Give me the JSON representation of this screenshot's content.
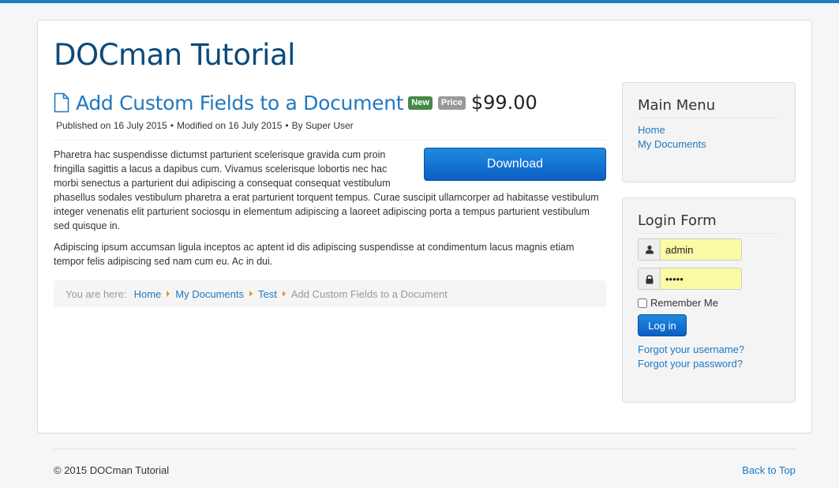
{
  "site": {
    "brand": "DOCman Tutorial"
  },
  "document": {
    "title": "Add Custom Fields to a Document",
    "badge_new": "New",
    "badge_price": "Price",
    "price": "$99.00",
    "published": "Published on 16 July 2015",
    "modified": "Modified on 16 July 2015",
    "author": "By Super User",
    "download_label": "Download",
    "paragraphs": [
      "Pharetra hac suspendisse dictumst parturient scelerisque gravida cum proin fringilla sagittis a lacus a dapibus cum. Vivamus scelerisque lobortis nec hac morbi senectus a parturient dui adipiscing a consequat consequat vestibulum phasellus sodales vestibulum pharetra a erat parturient torquent tempus. Curae suscipit ullamcorper ad habitasse vestibulum integer venenatis elit parturient sociosqu in elementum adipiscing a laoreet adipiscing porta a tempus parturient vestibulum sed quisque in.",
      "Adipiscing ipsum accumsan ligula inceptos ac aptent id dis adipiscing suspendisse at condimentum lacus magnis etiam tempor felis adipiscing sed nam cum eu. Ac in dui."
    ]
  },
  "breadcrumb": {
    "prefix": "You are here:",
    "items": [
      "Home",
      "My Documents",
      "Test",
      "Add Custom Fields to a Document"
    ]
  },
  "main_menu": {
    "title": "Main Menu",
    "items": [
      "Home",
      "My Documents"
    ]
  },
  "login": {
    "title": "Login Form",
    "username_value": "admin",
    "password_value": "•••••",
    "remember_label": "Remember Me",
    "submit_label": "Log in",
    "forgot_username": "Forgot your username?",
    "forgot_password": "Forgot your password?"
  },
  "footer": {
    "copyright": "© 2015 DOCman Tutorial",
    "back_to_top": "Back to Top"
  },
  "colors": {
    "accent": "#1f78c2",
    "brand": "#0d4a7a",
    "badge_new": "#468847",
    "breadcrumb_separator": "#e8961e"
  }
}
